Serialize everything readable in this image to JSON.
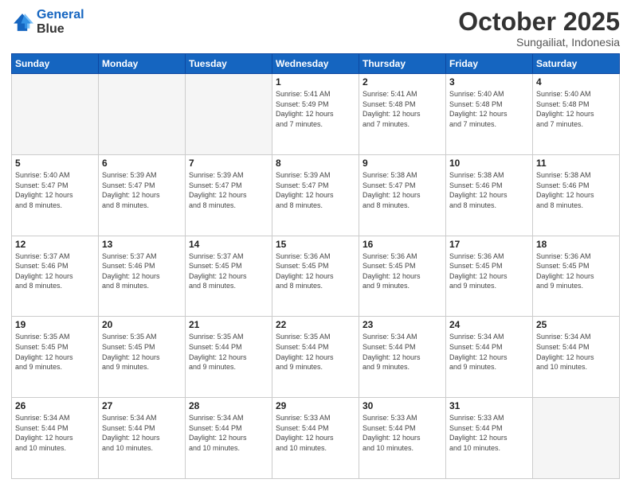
{
  "header": {
    "logo_line1": "General",
    "logo_line2": "Blue",
    "title": "October 2025",
    "subtitle": "Sungailiat, Indonesia"
  },
  "weekdays": [
    "Sunday",
    "Monday",
    "Tuesday",
    "Wednesday",
    "Thursday",
    "Friday",
    "Saturday"
  ],
  "weeks": [
    [
      {
        "day": "",
        "info": "",
        "empty": true
      },
      {
        "day": "",
        "info": "",
        "empty": true
      },
      {
        "day": "",
        "info": "",
        "empty": true
      },
      {
        "day": "1",
        "info": "Sunrise: 5:41 AM\nSunset: 5:49 PM\nDaylight: 12 hours\nand 7 minutes.",
        "empty": false
      },
      {
        "day": "2",
        "info": "Sunrise: 5:41 AM\nSunset: 5:48 PM\nDaylight: 12 hours\nand 7 minutes.",
        "empty": false
      },
      {
        "day": "3",
        "info": "Sunrise: 5:40 AM\nSunset: 5:48 PM\nDaylight: 12 hours\nand 7 minutes.",
        "empty": false
      },
      {
        "day": "4",
        "info": "Sunrise: 5:40 AM\nSunset: 5:48 PM\nDaylight: 12 hours\nand 7 minutes.",
        "empty": false
      }
    ],
    [
      {
        "day": "5",
        "info": "Sunrise: 5:40 AM\nSunset: 5:47 PM\nDaylight: 12 hours\nand 8 minutes.",
        "empty": false
      },
      {
        "day": "6",
        "info": "Sunrise: 5:39 AM\nSunset: 5:47 PM\nDaylight: 12 hours\nand 8 minutes.",
        "empty": false
      },
      {
        "day": "7",
        "info": "Sunrise: 5:39 AM\nSunset: 5:47 PM\nDaylight: 12 hours\nand 8 minutes.",
        "empty": false
      },
      {
        "day": "8",
        "info": "Sunrise: 5:39 AM\nSunset: 5:47 PM\nDaylight: 12 hours\nand 8 minutes.",
        "empty": false
      },
      {
        "day": "9",
        "info": "Sunrise: 5:38 AM\nSunset: 5:47 PM\nDaylight: 12 hours\nand 8 minutes.",
        "empty": false
      },
      {
        "day": "10",
        "info": "Sunrise: 5:38 AM\nSunset: 5:46 PM\nDaylight: 12 hours\nand 8 minutes.",
        "empty": false
      },
      {
        "day": "11",
        "info": "Sunrise: 5:38 AM\nSunset: 5:46 PM\nDaylight: 12 hours\nand 8 minutes.",
        "empty": false
      }
    ],
    [
      {
        "day": "12",
        "info": "Sunrise: 5:37 AM\nSunset: 5:46 PM\nDaylight: 12 hours\nand 8 minutes.",
        "empty": false
      },
      {
        "day": "13",
        "info": "Sunrise: 5:37 AM\nSunset: 5:46 PM\nDaylight: 12 hours\nand 8 minutes.",
        "empty": false
      },
      {
        "day": "14",
        "info": "Sunrise: 5:37 AM\nSunset: 5:45 PM\nDaylight: 12 hours\nand 8 minutes.",
        "empty": false
      },
      {
        "day": "15",
        "info": "Sunrise: 5:36 AM\nSunset: 5:45 PM\nDaylight: 12 hours\nand 8 minutes.",
        "empty": false
      },
      {
        "day": "16",
        "info": "Sunrise: 5:36 AM\nSunset: 5:45 PM\nDaylight: 12 hours\nand 9 minutes.",
        "empty": false
      },
      {
        "day": "17",
        "info": "Sunrise: 5:36 AM\nSunset: 5:45 PM\nDaylight: 12 hours\nand 9 minutes.",
        "empty": false
      },
      {
        "day": "18",
        "info": "Sunrise: 5:36 AM\nSunset: 5:45 PM\nDaylight: 12 hours\nand 9 minutes.",
        "empty": false
      }
    ],
    [
      {
        "day": "19",
        "info": "Sunrise: 5:35 AM\nSunset: 5:45 PM\nDaylight: 12 hours\nand 9 minutes.",
        "empty": false
      },
      {
        "day": "20",
        "info": "Sunrise: 5:35 AM\nSunset: 5:45 PM\nDaylight: 12 hours\nand 9 minutes.",
        "empty": false
      },
      {
        "day": "21",
        "info": "Sunrise: 5:35 AM\nSunset: 5:44 PM\nDaylight: 12 hours\nand 9 minutes.",
        "empty": false
      },
      {
        "day": "22",
        "info": "Sunrise: 5:35 AM\nSunset: 5:44 PM\nDaylight: 12 hours\nand 9 minutes.",
        "empty": false
      },
      {
        "day": "23",
        "info": "Sunrise: 5:34 AM\nSunset: 5:44 PM\nDaylight: 12 hours\nand 9 minutes.",
        "empty": false
      },
      {
        "day": "24",
        "info": "Sunrise: 5:34 AM\nSunset: 5:44 PM\nDaylight: 12 hours\nand 9 minutes.",
        "empty": false
      },
      {
        "day": "25",
        "info": "Sunrise: 5:34 AM\nSunset: 5:44 PM\nDaylight: 12 hours\nand 10 minutes.",
        "empty": false
      }
    ],
    [
      {
        "day": "26",
        "info": "Sunrise: 5:34 AM\nSunset: 5:44 PM\nDaylight: 12 hours\nand 10 minutes.",
        "empty": false
      },
      {
        "day": "27",
        "info": "Sunrise: 5:34 AM\nSunset: 5:44 PM\nDaylight: 12 hours\nand 10 minutes.",
        "empty": false
      },
      {
        "day": "28",
        "info": "Sunrise: 5:34 AM\nSunset: 5:44 PM\nDaylight: 12 hours\nand 10 minutes.",
        "empty": false
      },
      {
        "day": "29",
        "info": "Sunrise: 5:33 AM\nSunset: 5:44 PM\nDaylight: 12 hours\nand 10 minutes.",
        "empty": false
      },
      {
        "day": "30",
        "info": "Sunrise: 5:33 AM\nSunset: 5:44 PM\nDaylight: 12 hours\nand 10 minutes.",
        "empty": false
      },
      {
        "day": "31",
        "info": "Sunrise: 5:33 AM\nSunset: 5:44 PM\nDaylight: 12 hours\nand 10 minutes.",
        "empty": false
      },
      {
        "day": "",
        "info": "",
        "empty": true
      }
    ]
  ]
}
